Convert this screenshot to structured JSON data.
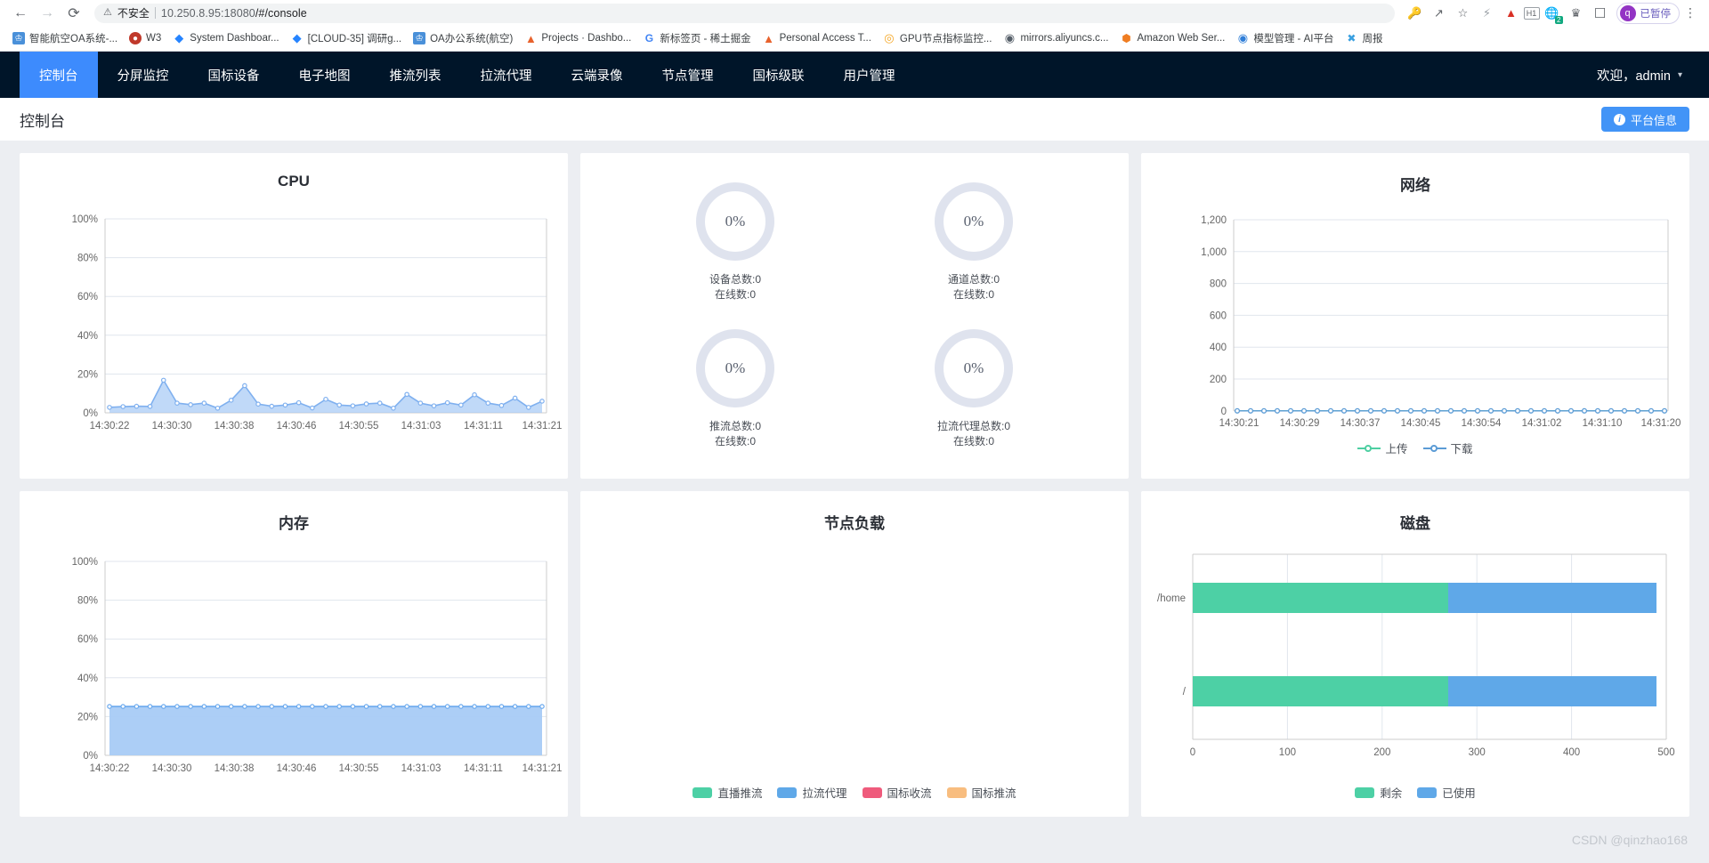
{
  "browser": {
    "back_icon": "back-arrow-icon",
    "forward_icon": "forward-arrow-icon",
    "reload_icon": "reload-icon",
    "security_label": "不安全",
    "url": "10.250.8.95:18080/#/console",
    "url_host": "10.250.8.95:18080",
    "url_path": "/#/console",
    "profile_letter": "q",
    "profile_status": "已暂停",
    "extension_badge": "2",
    "bookmarks": [
      {
        "label": "智能航空OA系统-...",
        "icon": "#4a90d9",
        "glyph": "♟"
      },
      {
        "label": "W3",
        "icon": "#c0392b",
        "glyph": "●"
      },
      {
        "label": "System Dashboar...",
        "icon": "#2684ff",
        "glyph": "◆"
      },
      {
        "label": "[CLOUD-35] 调研g...",
        "icon": "#2684ff",
        "glyph": "◆"
      },
      {
        "label": "OA办公系统(航空)",
        "icon": "#4a90d9",
        "glyph": "♟"
      },
      {
        "label": "Projects · Dashbo...",
        "icon": "#e8622c",
        "glyph": "▲"
      },
      {
        "label": "新标签页 - 稀土掘金",
        "icon": "#ffffff",
        "glyph": "G"
      },
      {
        "label": "Personal Access T...",
        "icon": "#e8622c",
        "glyph": "▲"
      },
      {
        "label": "GPU节点指标监控...",
        "icon": "#f5a623",
        "glyph": "◎"
      },
      {
        "label": "mirrors.aliyuncs.c...",
        "icon": "#555e68",
        "glyph": "◔"
      },
      {
        "label": "Amazon Web Ser...",
        "icon": "#ef7d22",
        "glyph": "⬢"
      },
      {
        "label": "模型管理 - AI平台",
        "icon": "#2f7ed8",
        "glyph": "◉"
      },
      {
        "label": "周报",
        "icon": "#3aa0e0",
        "glyph": "✖"
      }
    ]
  },
  "nav": {
    "items": [
      {
        "label": "控制台",
        "active": true
      },
      {
        "label": "分屏监控",
        "active": false
      },
      {
        "label": "国标设备",
        "active": false
      },
      {
        "label": "电子地图",
        "active": false
      },
      {
        "label": "推流列表",
        "active": false
      },
      {
        "label": "拉流代理",
        "active": false
      },
      {
        "label": "云端录像",
        "active": false
      },
      {
        "label": "节点管理",
        "active": false
      },
      {
        "label": "国标级联",
        "active": false
      },
      {
        "label": "用户管理",
        "active": false
      }
    ],
    "user_label": "欢迎，admin",
    "caret": "⌄"
  },
  "header": {
    "title": "控制台",
    "info_button": "平台信息",
    "info_icon_glyph": "i"
  },
  "gauges": [
    {
      "percent": "0%",
      "total_label": "设备总数:0",
      "online_label": "在线数:0"
    },
    {
      "percent": "0%",
      "total_label": "通道总数:0",
      "online_label": "在线数:0"
    },
    {
      "percent": "0%",
      "total_label": "推流总数:0",
      "online_label": "在线数:0"
    },
    {
      "percent": "0%",
      "total_label": "拉流代理总数:0",
      "online_label": "在线数:0"
    }
  ],
  "colors": {
    "accent": "#4294f7",
    "nav_bg": "#001529",
    "cpu_line": "#72a9f0",
    "cpu_fill": "#a8cbf5",
    "mem_line": "#6aa9ee",
    "mem_fill": "#a8cbf5",
    "net_upload": "#4ecfa2",
    "net_download": "#5b9bd5",
    "disk_free": "#4dd0a5",
    "disk_used": "#5fa8e8",
    "load_live": "#4dd0a5",
    "load_proxy": "#5fa8e8",
    "load_gb_in": "#ef5b7c",
    "load_gb_out": "#f8bd7f"
  },
  "chart_data": [
    {
      "type": "area",
      "name": "cpu",
      "title": "CPU",
      "xlabel": "",
      "ylabel": "",
      "ylim": [
        0,
        100
      ],
      "yticks": [
        "0%",
        "20%",
        "40%",
        "60%",
        "80%",
        "100%"
      ],
      "xticks": [
        "14:30:22",
        "14:30:30",
        "14:30:38",
        "14:30:46",
        "14:30:55",
        "14:31:03",
        "14:31:11",
        "14:31:21"
      ],
      "values": [
        2.8,
        3.2,
        3.4,
        3.3,
        16.8,
        5.0,
        4.2,
        5.0,
        2.4,
        6.5,
        14.0,
        4.5,
        3.4,
        4.0,
        5.2,
        2.5,
        7.0,
        4.0,
        3.6,
        4.6,
        5.0,
        2.4,
        9.5,
        5.0,
        3.6,
        5.2,
        4.0,
        9.3,
        5.0,
        3.8,
        7.6,
        2.8,
        6.0
      ],
      "grid": true,
      "legend": null
    },
    {
      "type": "line",
      "name": "network",
      "title": "网络",
      "xlabel": "",
      "ylabel": "",
      "ylim": [
        0,
        1200
      ],
      "yticks": [
        "0",
        "200",
        "400",
        "600",
        "800",
        "1,000",
        "1,200"
      ],
      "xticks": [
        "14:30:21",
        "14:30:29",
        "14:30:37",
        "14:30:45",
        "14:30:54",
        "14:31:02",
        "14:31:10",
        "14:31:20"
      ],
      "series": [
        {
          "name": "上传",
          "color": "#4ecfa2",
          "values": [
            0,
            0,
            0,
            0,
            0,
            0,
            0,
            0,
            0,
            0,
            0,
            0,
            0,
            0,
            0,
            0,
            0,
            0,
            0,
            0,
            0,
            0,
            0,
            0,
            0,
            0,
            0,
            0,
            0,
            0,
            0,
            0,
            0
          ]
        },
        {
          "name": "下载",
          "color": "#5b9bd5",
          "values": [
            0,
            0,
            0,
            0,
            0,
            0,
            0,
            0,
            0,
            0,
            0,
            0,
            0,
            0,
            0,
            0,
            0,
            0,
            0,
            0,
            0,
            0,
            0,
            0,
            0,
            0,
            0,
            0,
            0,
            0,
            0,
            0,
            0
          ]
        }
      ],
      "grid": true,
      "legend": "bottom"
    },
    {
      "type": "area",
      "name": "memory",
      "title": "内存",
      "xlabel": "",
      "ylabel": "",
      "ylim": [
        0,
        100
      ],
      "yticks": [
        "0%",
        "20%",
        "40%",
        "60%",
        "80%",
        "100%"
      ],
      "xticks": [
        "14:30:22",
        "14:30:30",
        "14:30:38",
        "14:30:46",
        "14:30:55",
        "14:31:03",
        "14:31:11",
        "14:31:21"
      ],
      "values": [
        25.2,
        25.2,
        25.2,
        25.2,
        25.2,
        25.2,
        25.2,
        25.2,
        25.2,
        25.2,
        25.2,
        25.2,
        25.2,
        25.2,
        25.2,
        25.2,
        25.2,
        25.2,
        25.2,
        25.2,
        25.2,
        25.2,
        25.2,
        25.2,
        25.2,
        25.2,
        25.2,
        25.2,
        25.2,
        25.2,
        25.2,
        25.2,
        25.2
      ],
      "grid": true,
      "legend": null
    },
    {
      "type": "bar",
      "name": "node-load",
      "title": "节点负载",
      "categories": [],
      "series": [
        {
          "name": "直播推流",
          "color": "#4dd0a5",
          "values": []
        },
        {
          "name": "拉流代理",
          "color": "#5fa8e8",
          "values": []
        },
        {
          "name": "国标收流",
          "color": "#ef5b7c",
          "values": []
        },
        {
          "name": "国标推流",
          "color": "#f8bd7f",
          "values": []
        }
      ],
      "legend": "bottom",
      "grid": false
    },
    {
      "type": "bar",
      "name": "disk",
      "title": "磁盘",
      "orientation": "horizontal",
      "categories": [
        "/home",
        "/"
      ],
      "xticks": [
        "0",
        "100",
        "200",
        "300",
        "400",
        "500"
      ],
      "xlim": [
        0,
        500
      ],
      "series": [
        {
          "name": "剩余",
          "color": "#4dd0a5",
          "values": [
            270,
            270
          ]
        },
        {
          "name": "已使用",
          "color": "#5fa8e8",
          "values": [
            220,
            220
          ]
        }
      ],
      "legend": "bottom",
      "grid": true
    }
  ],
  "watermark": "CSDN @qinzhao168"
}
